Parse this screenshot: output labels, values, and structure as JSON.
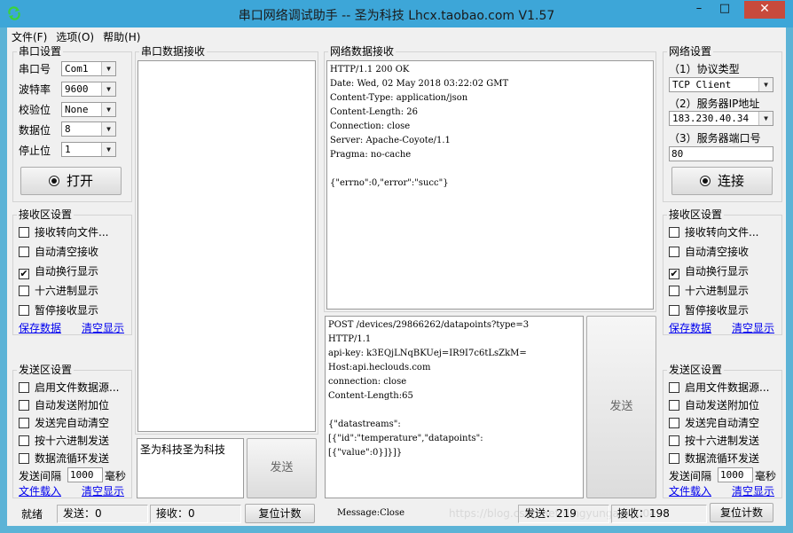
{
  "window": {
    "title": "串口网络调试助手 -- 圣为科技 Lhcx.taobao.com V1.57",
    "min_glyph": "–",
    "max_glyph": "□",
    "close_glyph": "✕",
    "titlebar_color": "#3da6d8",
    "close_color": "#c84a3c"
  },
  "menu": [
    "文件(F)",
    "选项(O)",
    "帮助(H)"
  ],
  "serial_settings": {
    "title": "串口设置",
    "rows": [
      {
        "label": "串口号",
        "value": "Com1"
      },
      {
        "label": "波特率",
        "value": "9600"
      },
      {
        "label": "校验位",
        "value": "None"
      },
      {
        "label": "数据位",
        "value": "8"
      },
      {
        "label": "停止位",
        "value": "1"
      }
    ],
    "open_button": "打开"
  },
  "left_receive": {
    "title": "接收区设置",
    "options": [
      {
        "label": "接收转向文件...",
        "checked": false
      },
      {
        "label": "自动清空接收",
        "checked": false
      },
      {
        "label": "自动换行显示",
        "checked": true
      },
      {
        "label": "十六进制显示",
        "checked": false
      },
      {
        "label": "暂停接收显示",
        "checked": false
      }
    ],
    "save_link": "保存数据",
    "clear_link": "清空显示"
  },
  "left_send": {
    "title": "发送区设置",
    "options": [
      {
        "label": "启用文件数据源...",
        "checked": false
      },
      {
        "label": "自动发送附加位",
        "checked": false
      },
      {
        "label": "发送完自动清空",
        "checked": false
      },
      {
        "label": "按十六进制发送",
        "checked": false
      },
      {
        "label": "数据流循环发送",
        "checked": false
      }
    ],
    "interval_label": "发送间隔",
    "interval_value": "1000",
    "interval_unit": "毫秒",
    "load_link": "文件载入",
    "clear_link": "清空显示"
  },
  "serial_receive": {
    "title": "串口数据接收",
    "content": ""
  },
  "serial_send": {
    "content": "圣为科技圣为科技",
    "send_button": "发送"
  },
  "network_receive": {
    "title": "网络数据接收",
    "content": "HTTP/1.1 200 OK\nDate: Wed, 02 May 2018 03:22:02 GMT\nContent-Type: application/json\nContent-Length: 26\nConnection: close\nServer: Apache-Coyote/1.1\nPragma: no-cache\n\n{\"errno\":0,\"error\":\"succ\"}"
  },
  "network_send": {
    "content": "POST /devices/29866262/datapoints?type=3\nHTTP/1.1\napi-key: k3EQjLNqBKUej=IR9I7c6tLsZkM=\nHost:api.heclouds.com\nconnection: close\nContent-Length:65\n\n{\"datastreams\":\n[{\"id\":\"temperature\",\"datapoints\":\n[{\"value\":0}]}]}",
    "send_button": "发送"
  },
  "network_settings": {
    "title": "网络设置",
    "protocol_label": "（1）协议类型",
    "protocol_value": "TCP Client",
    "ip_label": "（2）服务器IP地址",
    "ip_value": "183.230.40.34",
    "port_label": "（3）服务器端口号",
    "port_value": "80",
    "connect_button": "连接"
  },
  "right_receive": {
    "title": "接收区设置",
    "options": [
      {
        "label": "接收转向文件...",
        "checked": false
      },
      {
        "label": "自动清空接收",
        "checked": false
      },
      {
        "label": "自动换行显示",
        "checked": true
      },
      {
        "label": "十六进制显示",
        "checked": false
      },
      {
        "label": "暂停接收显示",
        "checked": false
      }
    ],
    "save_link": "保存数据",
    "clear_link": "清空显示"
  },
  "right_send": {
    "title": "发送区设置",
    "options": [
      {
        "label": "启用文件数据源...",
        "checked": false
      },
      {
        "label": "自动发送附加位",
        "checked": false
      },
      {
        "label": "发送完自动清空",
        "checked": false
      },
      {
        "label": "按十六进制发送",
        "checked": false
      },
      {
        "label": "数据流循环发送",
        "checked": false
      }
    ],
    "interval_label": "发送间隔",
    "interval_value": "1000",
    "interval_unit": "毫秒",
    "load_link": "文件载入",
    "clear_link": "清空显示"
  },
  "status_left": {
    "state": "就绪",
    "sent": "发送：0",
    "received": "接收：0",
    "reset_button": "复位计数"
  },
  "status_right": {
    "message": "Message:Close",
    "sent": "发送：219",
    "received": "接收：198",
    "reset_button": "复位计数"
  },
  "icons": {
    "app": "refresh-arrows-icon",
    "checked_mark": "✔"
  },
  "watermark": "https://blog.csdn.net/dingyunga...2004"
}
